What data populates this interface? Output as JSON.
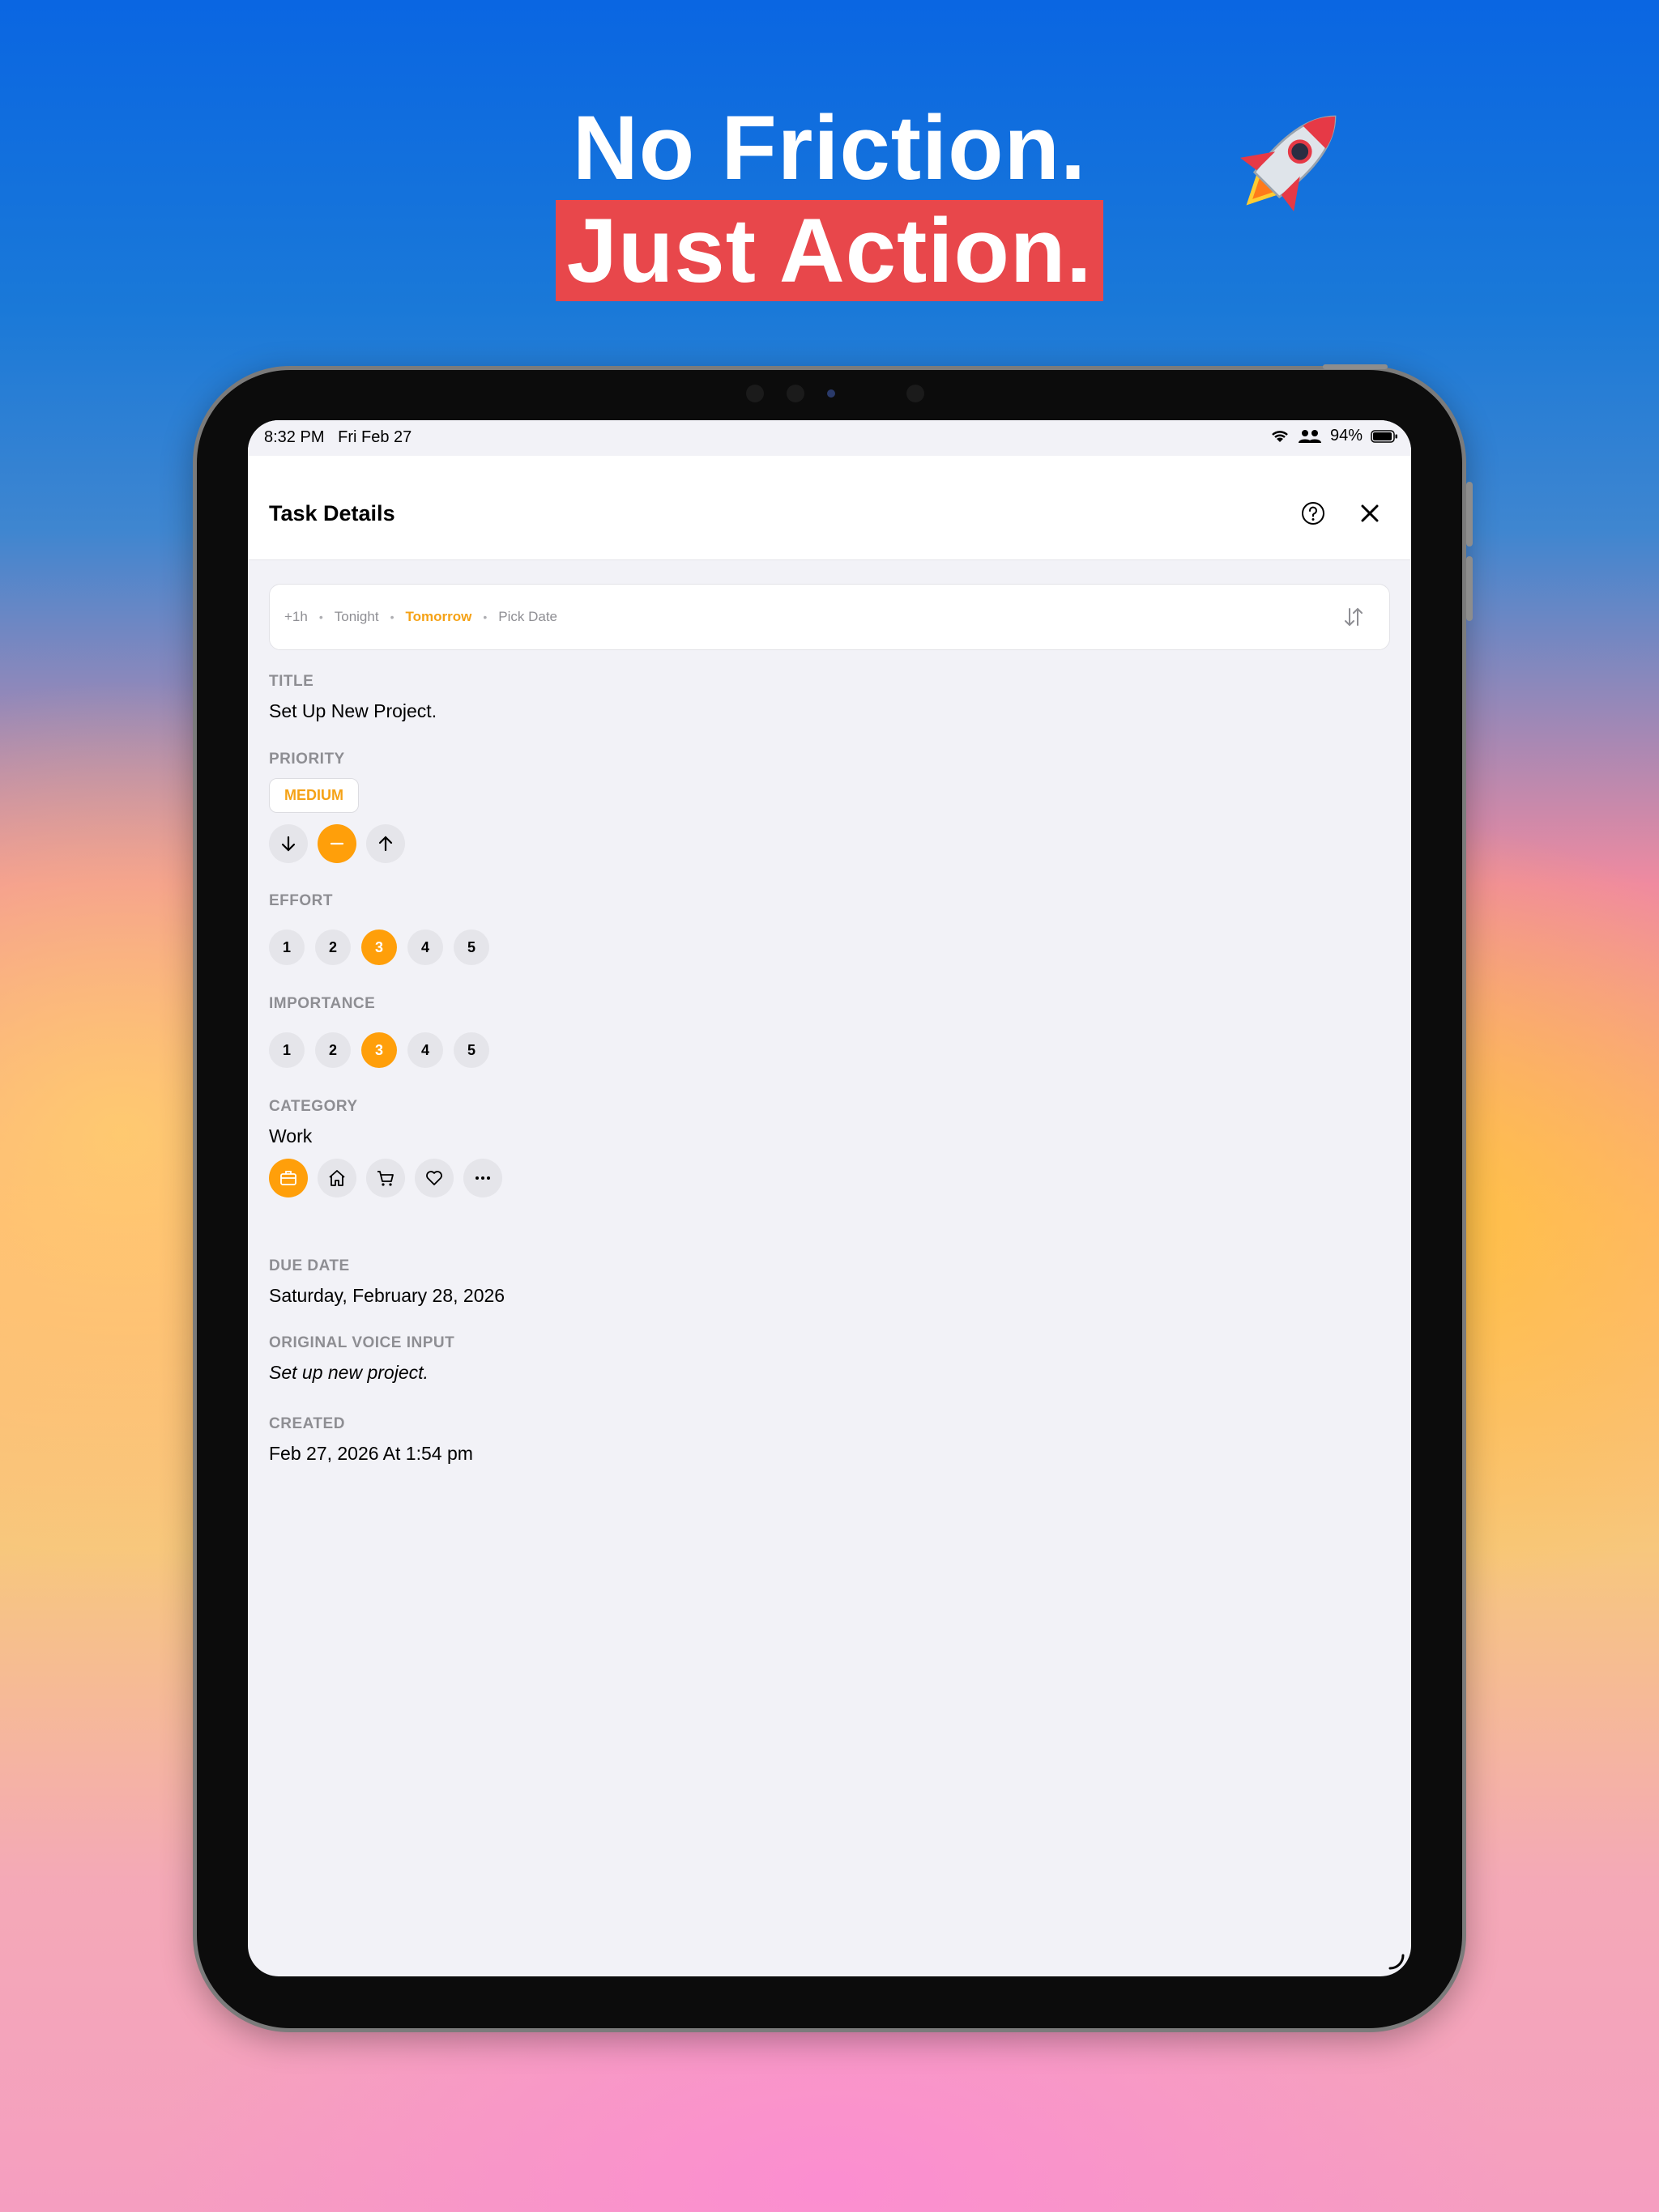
{
  "headline": {
    "line1": "No Friction.",
    "line2": "Just Action."
  },
  "status": {
    "time": "8:32 PM",
    "date": "Fri Feb 27",
    "battery": "94%"
  },
  "nav": {
    "title": "Task Details"
  },
  "quick": {
    "opt1": "+1h",
    "opt2": "Tonight",
    "opt3": "Tomorrow",
    "opt4": "Pick Date",
    "sep": "•",
    "selected": "Tomorrow"
  },
  "title": {
    "label": "TITLE",
    "value": "Set Up New Project."
  },
  "priority": {
    "label": "PRIORITY",
    "value": "MEDIUM"
  },
  "effort": {
    "label": "EFFORT",
    "options": [
      "1",
      "2",
      "3",
      "4",
      "5"
    ],
    "selected": "3"
  },
  "importance": {
    "label": "IMPORTANCE",
    "options": [
      "1",
      "2",
      "3",
      "4",
      "5"
    ],
    "selected": "3"
  },
  "category": {
    "label": "CATEGORY",
    "value": "Work",
    "icons": [
      "briefcase-icon",
      "home-icon",
      "cart-icon",
      "heart-icon",
      "more-icon"
    ]
  },
  "due": {
    "label": "DUE DATE",
    "value": "Saturday, February 28, 2026"
  },
  "voice": {
    "label": "ORIGINAL VOICE INPUT",
    "value": "Set up new project."
  },
  "created": {
    "label": "CREATED",
    "value": "Feb 27, 2026 At 1:54 pm"
  },
  "colors": {
    "accent": "#ff9f0a",
    "highlight": "#e8474b"
  }
}
